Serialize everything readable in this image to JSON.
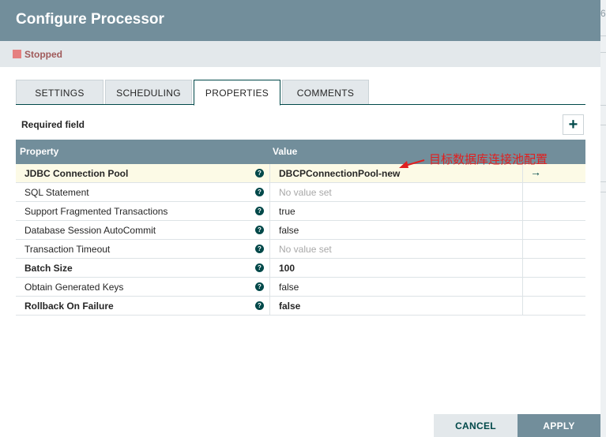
{
  "dialog": {
    "title": "Configure Processor"
  },
  "status": {
    "label": "Stopped",
    "color": "#e58080"
  },
  "tabs": [
    {
      "label": "SETTINGS",
      "active": false
    },
    {
      "label": "SCHEDULING",
      "active": false
    },
    {
      "label": "PROPERTIES",
      "active": true
    },
    {
      "label": "COMMENTS",
      "active": false
    }
  ],
  "properties_panel": {
    "required_label": "Required field",
    "add_icon": "plus-icon",
    "columns": {
      "property": "Property",
      "value": "Value"
    },
    "rows": [
      {
        "name": "JDBC Connection Pool",
        "required": true,
        "value": "DBCPConnectionPool-new",
        "empty": false,
        "action_icon": "arrow-right-icon"
      },
      {
        "name": "SQL Statement",
        "required": false,
        "value": "No value set",
        "empty": true
      },
      {
        "name": "Support Fragmented Transactions",
        "required": false,
        "value": "true",
        "empty": false
      },
      {
        "name": "Database Session AutoCommit",
        "required": false,
        "value": "false",
        "empty": false
      },
      {
        "name": "Transaction Timeout",
        "required": false,
        "value": "No value set",
        "empty": true
      },
      {
        "name": "Batch Size",
        "required": true,
        "value": "100",
        "empty": false
      },
      {
        "name": "Obtain Generated Keys",
        "required": false,
        "value": "false",
        "empty": false
      },
      {
        "name": "Rollback On Failure",
        "required": true,
        "value": "false",
        "empty": false
      }
    ]
  },
  "annotation": {
    "text": "目标数据库连接池配置",
    "color": "#e02020"
  },
  "footer": {
    "cancel_label": "CANCEL",
    "apply_label": "APPLY"
  },
  "background": {
    "partial_text": "6"
  },
  "colors": {
    "header": "#728e9b",
    "accent": "#004849",
    "status_bar": "#e3e8eb"
  }
}
